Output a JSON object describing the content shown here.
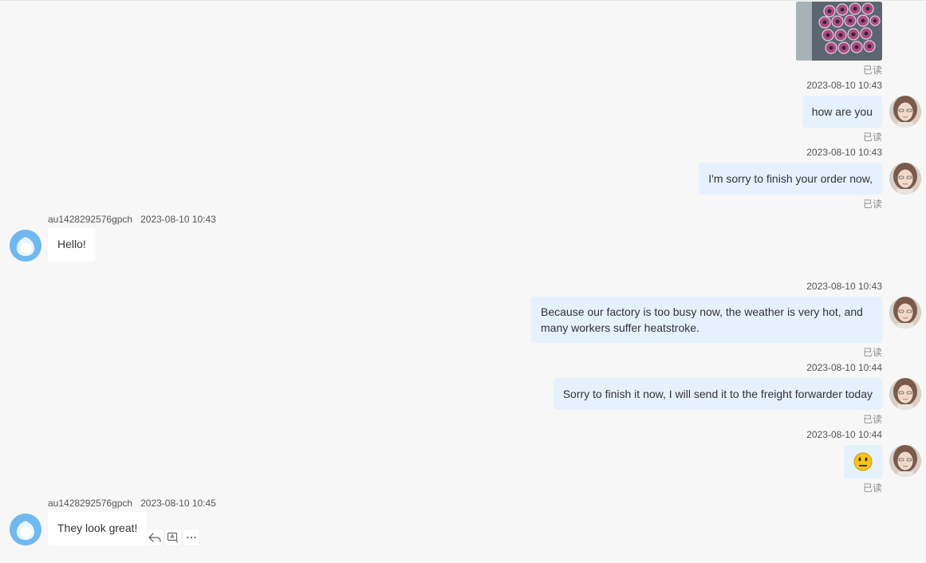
{
  "chat": {
    "image_message": {
      "read_status": "已读"
    },
    "messages": [
      {
        "timestamp": "2023-08-10 10:43",
        "text": "how are you",
        "read_status": "已读"
      },
      {
        "timestamp": "2023-08-10 10:43",
        "text": "I'm sorry to finish your order now,",
        "read_status": "已读"
      },
      {
        "sender": "au1428292576gpch",
        "timestamp": "2023-08-10 10:43",
        "text": "Hello!"
      },
      {
        "timestamp": "2023-08-10 10:43",
        "text": "Because our factory is too busy now, the weather is very hot, and many workers suffer heatstroke.",
        "read_status": "已读"
      },
      {
        "timestamp": "2023-08-10 10:44",
        "text": "Sorry to finish it now, I will send it to the freight forwarder today",
        "read_status": "已读"
      },
      {
        "timestamp": "2023-08-10 10:44",
        "emoji": "neutral-face-emoji",
        "read_status": "已读"
      },
      {
        "sender": "au1428292576gpch",
        "timestamp": "2023-08-10 10:45",
        "text": "They look great!"
      }
    ]
  },
  "actions": {
    "reply_icon": "reply-icon",
    "translate_icon": "translate-icon",
    "more_icon": "more-icon"
  },
  "colors": {
    "background": "#f7f7f7",
    "outgoing_bubble": "#e5f1ff",
    "incoming_bubble": "#ffffff",
    "avatar_blue": "#6fb9ee"
  }
}
